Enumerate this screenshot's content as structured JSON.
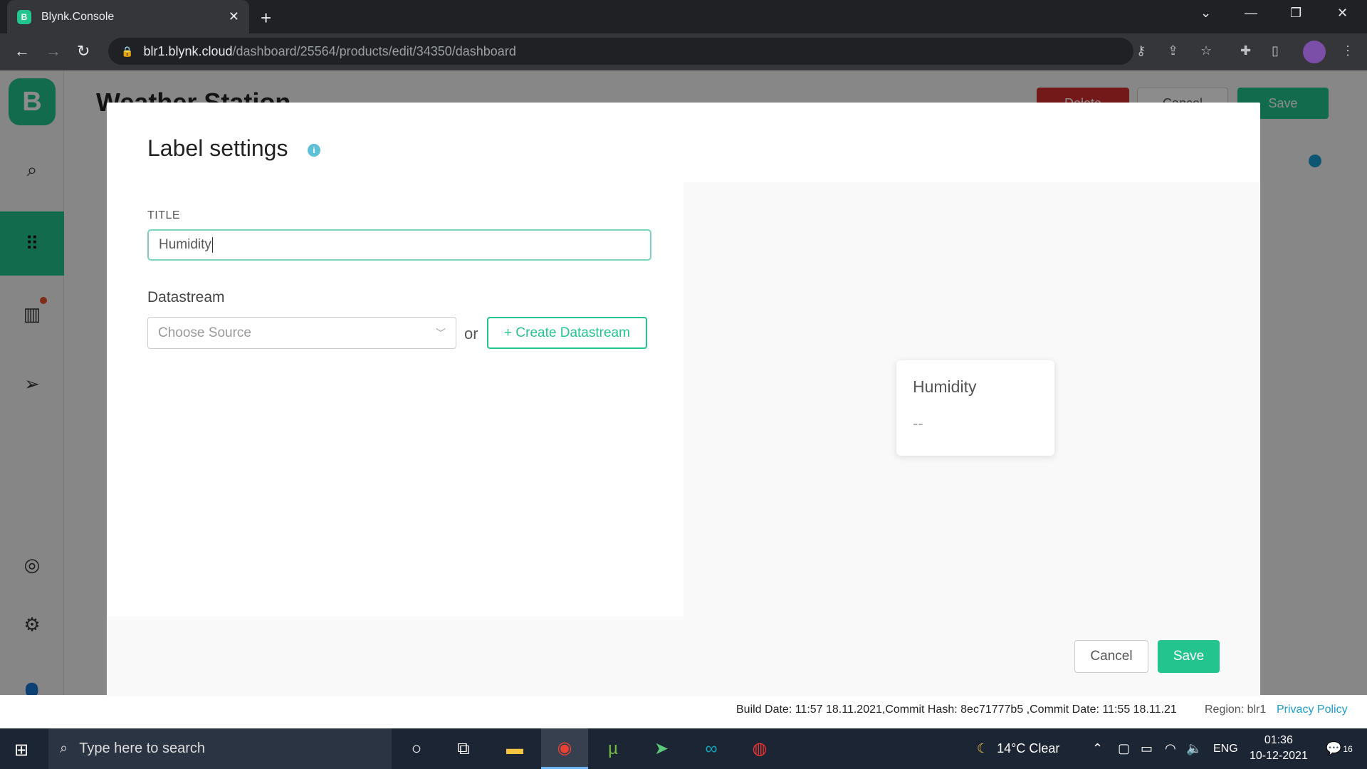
{
  "browser": {
    "tab_title": "Blynk.Console",
    "tab_favicon": "B",
    "url_host": "blr1.blynk.cloud",
    "url_path": "/dashboard/25564/products/edit/34350/dashboard"
  },
  "app": {
    "logo": "B",
    "page_title": "Weather Station",
    "header_buttons": {
      "delete": "Delete",
      "cancel": "Cancel",
      "save": "Save"
    },
    "sidebar_icons": [
      "search-icon",
      "dashboard-grid-icon",
      "organization-building-icon",
      "send-icon",
      "help-lifebuoy-icon",
      "settings-gear-icon",
      "user-icon"
    ],
    "footer": {
      "build_info": "Build Date: 11:57 18.11.2021,Commit Hash: 8ec71777b5 ,Commit Date: 11:55 18.11.21",
      "region": "Region: blr1",
      "privacy_link": "Privacy Policy"
    }
  },
  "modal": {
    "title": "Label settings",
    "title_field_label": "TITLE",
    "title_value": "Humidity",
    "datastream_label": "Datastream",
    "datastream_placeholder": "Choose Source",
    "or_text": "or",
    "create_datastream": "+ Create Datastream",
    "preview": {
      "title": "Humidity",
      "value": "--"
    },
    "cancel": "Cancel",
    "save": "Save"
  },
  "colors": {
    "accent": "#23c48e",
    "danger": "#d32f2f",
    "info": "#1a9fcf"
  },
  "taskbar": {
    "search_placeholder": "Type here to search",
    "weather": "14°C  Clear",
    "language": "ENG",
    "time": "01:36",
    "date": "10-12-2021",
    "notifications": "16"
  }
}
